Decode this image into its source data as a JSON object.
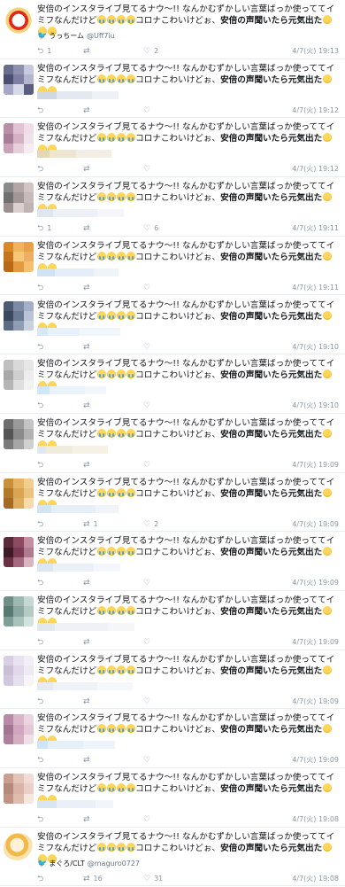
{
  "tweet_text_part1": "安倍のインスタライブ見てるナウ〜!! なんかむずかしい言葉ばっか使っててイミフなんだけど",
  "tweet_text_part2": "コロナこわいけどぉ、",
  "tweet_text_bold": "安倍の声聞いたら元気出た",
  "tweets": [
    {
      "user_display": "うっちーム",
      "user_handle": "@Uff7iu",
      "reply": "1",
      "retweet": "",
      "like": "2",
      "time": "4/7(火) 19:13"
    },
    {
      "reply": "",
      "retweet": "",
      "like": "",
      "time": "4/7(火) 19:12"
    },
    {
      "reply": "",
      "retweet": "",
      "like": "",
      "time": "4/7(火) 19:12"
    },
    {
      "reply": "1",
      "retweet": "",
      "like": "6",
      "time": "4/7(火) 19:11"
    },
    {
      "reply": "",
      "retweet": "",
      "like": "",
      "time": "4/7(火) 19:11"
    },
    {
      "reply": "",
      "retweet": "",
      "like": "",
      "time": "4/7(火) 19:10"
    },
    {
      "reply": "",
      "retweet": "",
      "like": "",
      "time": "4/7(火) 19:10"
    },
    {
      "reply": "",
      "retweet": "",
      "like": "",
      "time": "4/7(火) 19:09"
    },
    {
      "reply": "",
      "retweet": "1",
      "like": "2",
      "time": "4/7(火) 19:09"
    },
    {
      "reply": "",
      "retweet": "",
      "like": "",
      "time": "4/7(火) 19:09"
    },
    {
      "reply": "",
      "retweet": "",
      "like": "",
      "time": "4/7(火) 19:09"
    },
    {
      "reply": "",
      "retweet": "",
      "like": "",
      "time": "4/7(火) 19:09"
    },
    {
      "reply": "",
      "retweet": "",
      "like": "",
      "time": "4/7(火) 19:09"
    },
    {
      "reply": "",
      "retweet": "",
      "like": "",
      "time": "4/7(火) 19:08"
    },
    {
      "user_display": "まぐろ/CLT",
      "user_handle": "@maguro0727",
      "reply": "",
      "retweet": "16",
      "like": "31",
      "time": "4/7(火) 19:08"
    }
  ],
  "icons": {
    "reply": "reply-icon",
    "retweet": "retweet-icon",
    "like": "heart-icon",
    "bird": "twitter-bird-icon"
  },
  "colors": {
    "text": "#14171a",
    "muted": "#8899a6",
    "divider": "#e6ecf0",
    "link": "#1da1f2"
  }
}
